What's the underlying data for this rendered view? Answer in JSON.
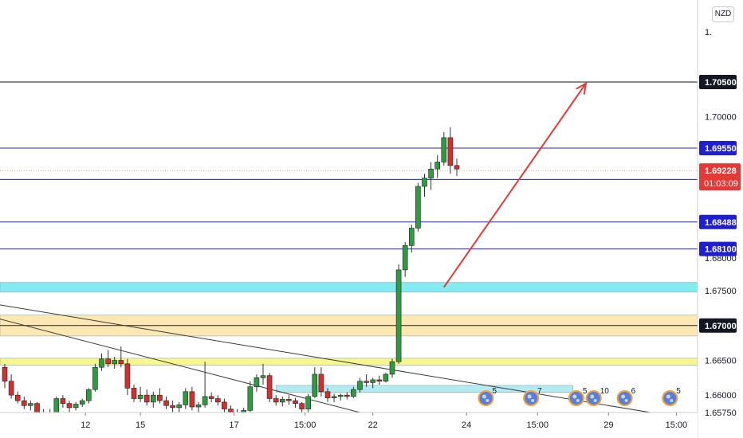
{
  "currency": "NZD",
  "chart_data": {
    "type": "candlestick",
    "y_range": [
      1.6575,
      1.7145
    ],
    "y_ticks": [
      "1.70000",
      "1.67500",
      "1.66500",
      "1.66000"
    ],
    "partial_labels": [
      {
        "value": 1.7122,
        "text": "1."
      },
      {
        "value": 1.6797,
        "text": "1.68000"
      },
      {
        "value": 1.6575,
        "text": "1.65750"
      }
    ],
    "x_labels": [
      {
        "idx": 12.5,
        "text": "12"
      },
      {
        "idx": 21,
        "text": "15"
      },
      {
        "idx": 35.5,
        "text": "17"
      },
      {
        "idx": 46.5,
        "text": "15:00"
      },
      {
        "idx": 57,
        "text": "22"
      },
      {
        "idx": 71.5,
        "text": "24"
      },
      {
        "idx": 82.5,
        "text": "15:00"
      },
      {
        "idx": 93.5,
        "text": "29"
      },
      {
        "idx": 104,
        "text": "15:00"
      }
    ],
    "horizontal_lines": [
      {
        "value": 1.705,
        "color": "#131722",
        "label": "1.70500"
      },
      {
        "value": 1.6955,
        "color": "#1f1fd0",
        "label": "1.69550"
      },
      {
        "value": 1.691,
        "color": "#1f1fd0",
        "label": ""
      },
      {
        "value": 1.68488,
        "color": "#1f1fd0",
        "label": "1.68488"
      },
      {
        "value": 1.681,
        "color": "#1f1fd0",
        "label": "1.68100"
      }
    ],
    "current_price": {
      "value": 1.69228,
      "label": "1.69228",
      "countdown": "01:03:09",
      "color": "#e53935"
    },
    "label_1670": "1.67000",
    "zones": [
      {
        "from": 1.6748,
        "to": 1.6762,
        "color": "#6fe8ee"
      },
      {
        "from": 1.6685,
        "to": 1.6715,
        "color": "#fde4a7"
      },
      {
        "from": 1.6643,
        "to": 1.6653,
        "color": "#f7f47a"
      },
      {
        "from": 1.6604,
        "to": 1.6614,
        "color": "#a6e7ef",
        "x_from": 42,
        "x_to": 88
      }
    ],
    "trendlines": [
      {
        "x1": -1,
        "y1": 1.673,
        "x2": 100,
        "y2": 1.6575,
        "color": "#3a3a3a"
      },
      {
        "x1": -1,
        "y1": 1.671,
        "x2": 55,
        "y2": 1.6575,
        "color": "#3a3a3a"
      }
    ],
    "arrow": {
      "x1": 68,
      "y1": 1.6755,
      "x2": 90,
      "y2": 1.7048,
      "color": "#e53935"
    },
    "events": [
      {
        "idx": 74.5,
        "count": "5"
      },
      {
        "idx": 81.5,
        "count": "7"
      },
      {
        "idx": 88.5,
        "count": "5"
      },
      {
        "idx": 91.2,
        "count": "10"
      },
      {
        "idx": 96,
        "count": "6"
      },
      {
        "idx": 103,
        "count": "5"
      }
    ],
    "candles": [
      [
        1.664,
        1.6645,
        1.661,
        1.662
      ],
      [
        1.662,
        1.663,
        1.6595,
        1.66
      ],
      [
        1.66,
        1.6605,
        1.6588,
        1.6592
      ],
      [
        1.6592,
        1.6598,
        1.658,
        1.6585
      ],
      [
        1.6585,
        1.6592,
        1.6578,
        1.6588
      ],
      [
        1.6588,
        1.659,
        1.657,
        1.6575
      ],
      [
        1.6575,
        1.658,
        1.656,
        1.6568
      ],
      [
        1.6568,
        1.658,
        1.656,
        1.6575
      ],
      [
        1.6575,
        1.6598,
        1.657,
        1.6595
      ],
      [
        1.6595,
        1.66,
        1.6582,
        1.6588
      ],
      [
        1.6588,
        1.6592,
        1.6575,
        1.6582
      ],
      [
        1.6582,
        1.659,
        1.6578,
        1.6587
      ],
      [
        1.6587,
        1.6595,
        1.6583,
        1.6592
      ],
      [
        1.6592,
        1.661,
        1.6588,
        1.6608
      ],
      [
        1.6608,
        1.6645,
        1.6605,
        1.664
      ],
      [
        1.664,
        1.666,
        1.6635,
        1.6652
      ],
      [
        1.6652,
        1.6665,
        1.664,
        1.6645
      ],
      [
        1.6645,
        1.6655,
        1.6638,
        1.665
      ],
      [
        1.665,
        1.667,
        1.664,
        1.6645
      ],
      [
        1.6645,
        1.6652,
        1.66,
        1.661
      ],
      [
        1.661,
        1.6615,
        1.659,
        1.6595
      ],
      [
        1.6595,
        1.6612,
        1.659,
        1.66
      ],
      [
        1.66,
        1.6608,
        1.6585,
        1.659
      ],
      [
        1.659,
        1.6605,
        1.6582,
        1.66
      ],
      [
        1.66,
        1.661,
        1.6588,
        1.6592
      ],
      [
        1.6592,
        1.6598,
        1.658,
        1.6585
      ],
      [
        1.6585,
        1.6592,
        1.6575,
        1.6582
      ],
      [
        1.6582,
        1.659,
        1.657,
        1.6586
      ],
      [
        1.6586,
        1.661,
        1.658,
        1.6605
      ],
      [
        1.6605,
        1.6612,
        1.6578,
        1.6583
      ],
      [
        1.6583,
        1.659,
        1.6575,
        1.6586
      ],
      [
        1.6586,
        1.6648,
        1.6582,
        1.6598
      ],
      [
        1.6598,
        1.6604,
        1.659,
        1.6595
      ],
      [
        1.6595,
        1.66,
        1.6585,
        1.659
      ],
      [
        1.659,
        1.6595,
        1.6575,
        1.658
      ],
      [
        1.658,
        1.6585,
        1.6565,
        1.6572
      ],
      [
        1.6572,
        1.658,
        1.656,
        1.6575
      ],
      [
        1.6575,
        1.6582,
        1.6568,
        1.6578
      ],
      [
        1.6578,
        1.662,
        1.6575,
        1.6612
      ],
      [
        1.6612,
        1.663,
        1.6605,
        1.6625
      ],
      [
        1.6625,
        1.6645,
        1.6615,
        1.6628
      ],
      [
        1.6628,
        1.6632,
        1.659,
        1.6595
      ],
      [
        1.6595,
        1.66,
        1.6585,
        1.659
      ],
      [
        1.659,
        1.6598,
        1.6584,
        1.6594
      ],
      [
        1.6594,
        1.66,
        1.6586,
        1.6592
      ],
      [
        1.6592,
        1.6596,
        1.6582,
        1.6588
      ],
      [
        1.6588,
        1.659,
        1.6575,
        1.658
      ],
      [
        1.658,
        1.6602,
        1.6575,
        1.6598
      ],
      [
        1.6598,
        1.664,
        1.6596,
        1.663
      ],
      [
        1.663,
        1.664,
        1.6598,
        1.6605
      ],
      [
        1.6605,
        1.661,
        1.659,
        1.6596
      ],
      [
        1.6596,
        1.6602,
        1.659,
        1.6598
      ],
      [
        1.6598,
        1.6602,
        1.6592,
        1.66
      ],
      [
        1.66,
        1.6604,
        1.6594,
        1.6598
      ],
      [
        1.6598,
        1.6612,
        1.6596,
        1.6608
      ],
      [
        1.6608,
        1.6625,
        1.6604,
        1.662
      ],
      [
        1.662,
        1.663,
        1.6612,
        1.6618
      ],
      [
        1.6618,
        1.6625,
        1.661,
        1.6622
      ],
      [
        1.6622,
        1.6628,
        1.6615,
        1.662
      ],
      [
        1.662,
        1.6632,
        1.6618,
        1.663
      ],
      [
        1.663,
        1.6652,
        1.6625,
        1.6648
      ],
      [
        1.6648,
        1.6788,
        1.6645,
        1.678
      ],
      [
        1.678,
        1.682,
        1.677,
        1.6815
      ],
      [
        1.6815,
        1.6845,
        1.6805,
        1.684
      ],
      [
        1.684,
        1.6905,
        1.6835,
        1.69
      ],
      [
        1.69,
        1.6918,
        1.6885,
        1.6912
      ],
      [
        1.6912,
        1.6935,
        1.6895,
        1.6925
      ],
      [
        1.6925,
        1.6945,
        1.6912,
        1.6935
      ],
      [
        1.6935,
        1.6978,
        1.693,
        1.697
      ],
      [
        1.697,
        1.6985,
        1.6918,
        1.693
      ],
      [
        1.693,
        1.694,
        1.6915,
        1.6925
      ]
    ]
  }
}
